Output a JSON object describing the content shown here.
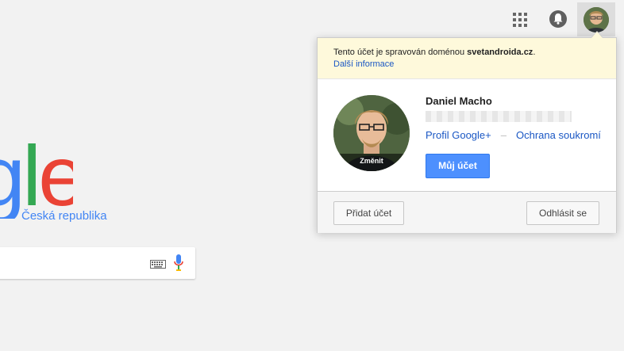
{
  "header": {
    "apps_icon": "apps-grid-icon",
    "notifications_icon": "bell-icon",
    "account_icon": "account-avatar"
  },
  "logo": {
    "letters": [
      "g",
      "l",
      "e"
    ],
    "subtitle": "Česká republika"
  },
  "search": {
    "keyboard_icon": "keyboard-icon",
    "mic_icon": "mic-icon"
  },
  "account_popup": {
    "notice_text": "Tento účet je spravován doménou",
    "notice_domain": "svetandroida.cz",
    "notice_suffix": ".",
    "notice_link": "Další informace",
    "change_photo": "Změnit",
    "name": "Daniel Macho",
    "profile_link": "Profil Google+",
    "separator": "–",
    "privacy_link": "Ochrana soukromí",
    "my_account_button": "Můj účet",
    "add_account_button": "Přidat účet",
    "sign_out_button": "Odhlásit se"
  },
  "colors": {
    "google_blue": "#4285f4",
    "google_green": "#34a853",
    "google_red": "#ea4335",
    "button_blue": "#4d90fe",
    "notice_bg": "#fef9db"
  }
}
